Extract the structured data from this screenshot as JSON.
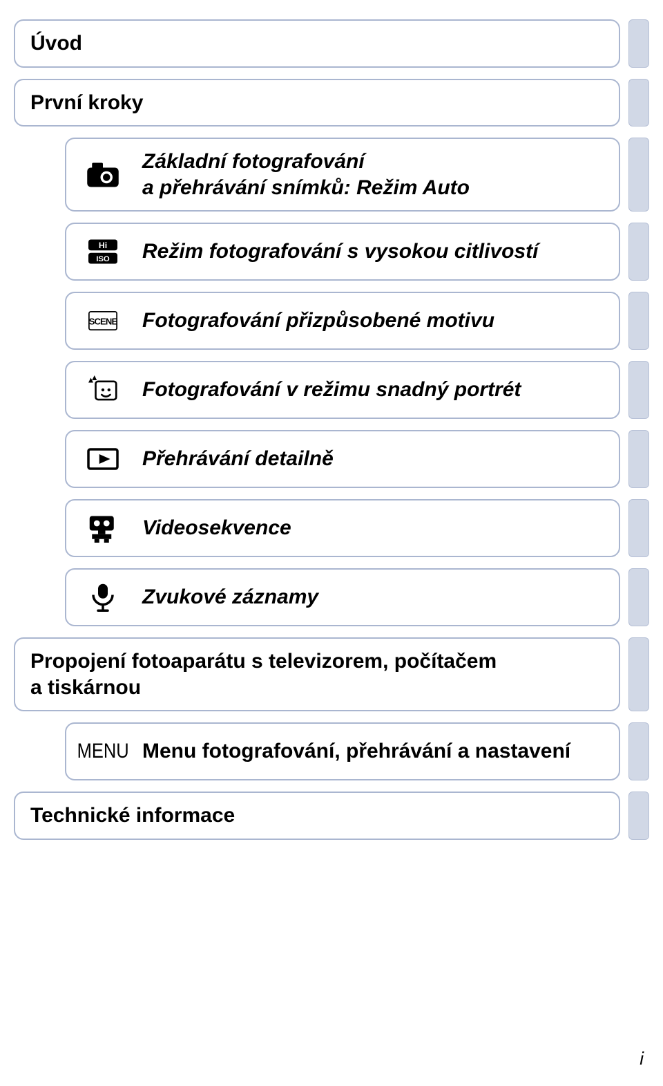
{
  "items": [
    {
      "label": "Úvod",
      "italic": false,
      "icon": "none",
      "indented": false,
      "multiline": false
    },
    {
      "label": "První kroky",
      "italic": false,
      "icon": "none",
      "indented": false,
      "multiline": false
    },
    {
      "label": "Základní fotografování\na přehrávání snímků: Režim Auto",
      "italic": true,
      "icon": "camera",
      "indented": true,
      "multiline": true
    },
    {
      "label": "Režim fotografování s vysokou citlivostí",
      "italic": true,
      "icon": "hi-iso",
      "indented": true,
      "multiline": false
    },
    {
      "label": "Fotografování přizpůsobené motivu",
      "italic": true,
      "icon": "scene",
      "indented": true,
      "multiline": false
    },
    {
      "label": "Fotografování v režimu snadný portrét",
      "italic": true,
      "icon": "portrait",
      "indented": true,
      "multiline": false
    },
    {
      "label": "Přehrávání detailně",
      "italic": true,
      "icon": "play",
      "indented": true,
      "multiline": false
    },
    {
      "label": "Videosekvence",
      "italic": true,
      "icon": "movie",
      "indented": true,
      "multiline": false
    },
    {
      "label": "Zvukové záznamy",
      "italic": true,
      "icon": "mic",
      "indented": true,
      "multiline": false
    },
    {
      "label": "Propojení fotoaparátu s televizorem, počítačem\na tiskárnou",
      "italic": false,
      "icon": "none",
      "indented": false,
      "multiline": true
    },
    {
      "label": "Menu fotografování, přehrávání a nastavení",
      "italic": false,
      "icon": "menu-text",
      "indented": true,
      "multiline": false
    },
    {
      "label": "Technické informace",
      "italic": false,
      "icon": "none",
      "indented": false,
      "multiline": false
    }
  ],
  "menuText": "MENU",
  "footer": "i"
}
